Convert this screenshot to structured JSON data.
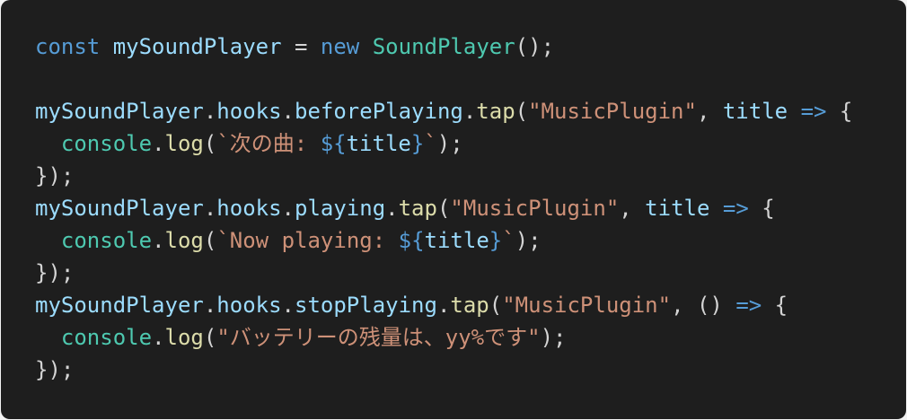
{
  "theme_colors": {
    "background": "#1e1e1e",
    "keyword": "#569cd6",
    "variable": "#9cdcfe",
    "class": "#4ec9b0",
    "function": "#dcdcaa",
    "string": "#ce9178",
    "punct": "#d4d4d4"
  },
  "code_lines": [
    [
      [
        "keyword",
        "const"
      ],
      [
        "punct",
        " "
      ],
      [
        "variable",
        "mySoundPlayer"
      ],
      [
        "punct",
        " = "
      ],
      [
        "keyword",
        "new"
      ],
      [
        "punct",
        " "
      ],
      [
        "class",
        "SoundPlayer"
      ],
      [
        "punct",
        "();"
      ]
    ],
    [],
    [
      [
        "variable",
        "mySoundPlayer"
      ],
      [
        "punct",
        "."
      ],
      [
        "variable",
        "hooks"
      ],
      [
        "punct",
        "."
      ],
      [
        "variable",
        "beforePlaying"
      ],
      [
        "punct",
        "."
      ],
      [
        "function",
        "tap"
      ],
      [
        "punct",
        "("
      ],
      [
        "string",
        "\"MusicPlugin\""
      ],
      [
        "punct",
        ", "
      ],
      [
        "variable",
        "title"
      ],
      [
        "punct",
        " "
      ],
      [
        "keyword",
        "=>"
      ],
      [
        "punct",
        " {"
      ]
    ],
    [
      [
        "punct",
        "  "
      ],
      [
        "class",
        "console"
      ],
      [
        "punct",
        "."
      ],
      [
        "function",
        "log"
      ],
      [
        "punct",
        "("
      ],
      [
        "string",
        "`次の曲: "
      ],
      [
        "keyword",
        "${"
      ],
      [
        "variable",
        "title"
      ],
      [
        "keyword",
        "}"
      ],
      [
        "string",
        "`"
      ],
      [
        "punct",
        ");"
      ]
    ],
    [
      [
        "punct",
        "});"
      ]
    ],
    [
      [
        "variable",
        "mySoundPlayer"
      ],
      [
        "punct",
        "."
      ],
      [
        "variable",
        "hooks"
      ],
      [
        "punct",
        "."
      ],
      [
        "variable",
        "playing"
      ],
      [
        "punct",
        "."
      ],
      [
        "function",
        "tap"
      ],
      [
        "punct",
        "("
      ],
      [
        "string",
        "\"MusicPlugin\""
      ],
      [
        "punct",
        ", "
      ],
      [
        "variable",
        "title"
      ],
      [
        "punct",
        " "
      ],
      [
        "keyword",
        "=>"
      ],
      [
        "punct",
        " {"
      ]
    ],
    [
      [
        "punct",
        "  "
      ],
      [
        "class",
        "console"
      ],
      [
        "punct",
        "."
      ],
      [
        "function",
        "log"
      ],
      [
        "punct",
        "("
      ],
      [
        "string",
        "`Now playing: "
      ],
      [
        "keyword",
        "${"
      ],
      [
        "variable",
        "title"
      ],
      [
        "keyword",
        "}"
      ],
      [
        "string",
        "`"
      ],
      [
        "punct",
        ");"
      ]
    ],
    [
      [
        "punct",
        "});"
      ]
    ],
    [
      [
        "variable",
        "mySoundPlayer"
      ],
      [
        "punct",
        "."
      ],
      [
        "variable",
        "hooks"
      ],
      [
        "punct",
        "."
      ],
      [
        "variable",
        "stopPlaying"
      ],
      [
        "punct",
        "."
      ],
      [
        "function",
        "tap"
      ],
      [
        "punct",
        "("
      ],
      [
        "string",
        "\"MusicPlugin\""
      ],
      [
        "punct",
        ", () "
      ],
      [
        "keyword",
        "=>"
      ],
      [
        "punct",
        " {"
      ]
    ],
    [
      [
        "punct",
        "  "
      ],
      [
        "class",
        "console"
      ],
      [
        "punct",
        "."
      ],
      [
        "function",
        "log"
      ],
      [
        "punct",
        "("
      ],
      [
        "string",
        "\"バッテリーの残量は、yy%です\""
      ],
      [
        "punct",
        ");"
      ]
    ],
    [
      [
        "punct",
        "});"
      ]
    ]
  ]
}
